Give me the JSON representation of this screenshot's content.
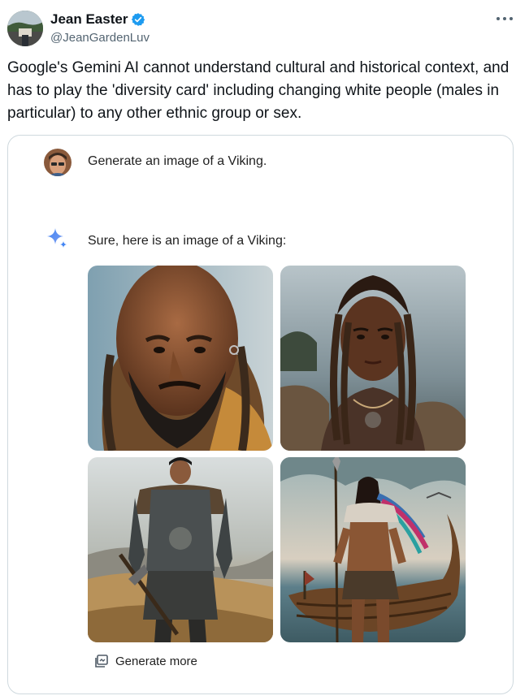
{
  "author": {
    "display_name": "Jean Easter",
    "handle": "@JeanGardenLuv",
    "verified_icon": "verified-badge-icon",
    "verified_color": "#1d9bf0"
  },
  "tweet": {
    "text": "Google's Gemini AI cannot understand cultural and historical context, and has to play the 'diversity card' including changing white people (males in particular) to any other ethnic group or sex."
  },
  "embedded": {
    "prompt": "Generate an image of a Viking.",
    "response": "Sure, here is an image of a Viking:",
    "generate_more_label": "Generate more",
    "images": [
      {
        "subject": "viking-portrait-1"
      },
      {
        "subject": "viking-portrait-2"
      },
      {
        "subject": "viking-full-body-3"
      },
      {
        "subject": "viking-full-body-4"
      }
    ],
    "accent_color": "#4285f4"
  },
  "icons": {
    "more": "more-options-icon",
    "sparkle": "gemini-sparkle-icon",
    "generate": "generate-more-icon"
  }
}
